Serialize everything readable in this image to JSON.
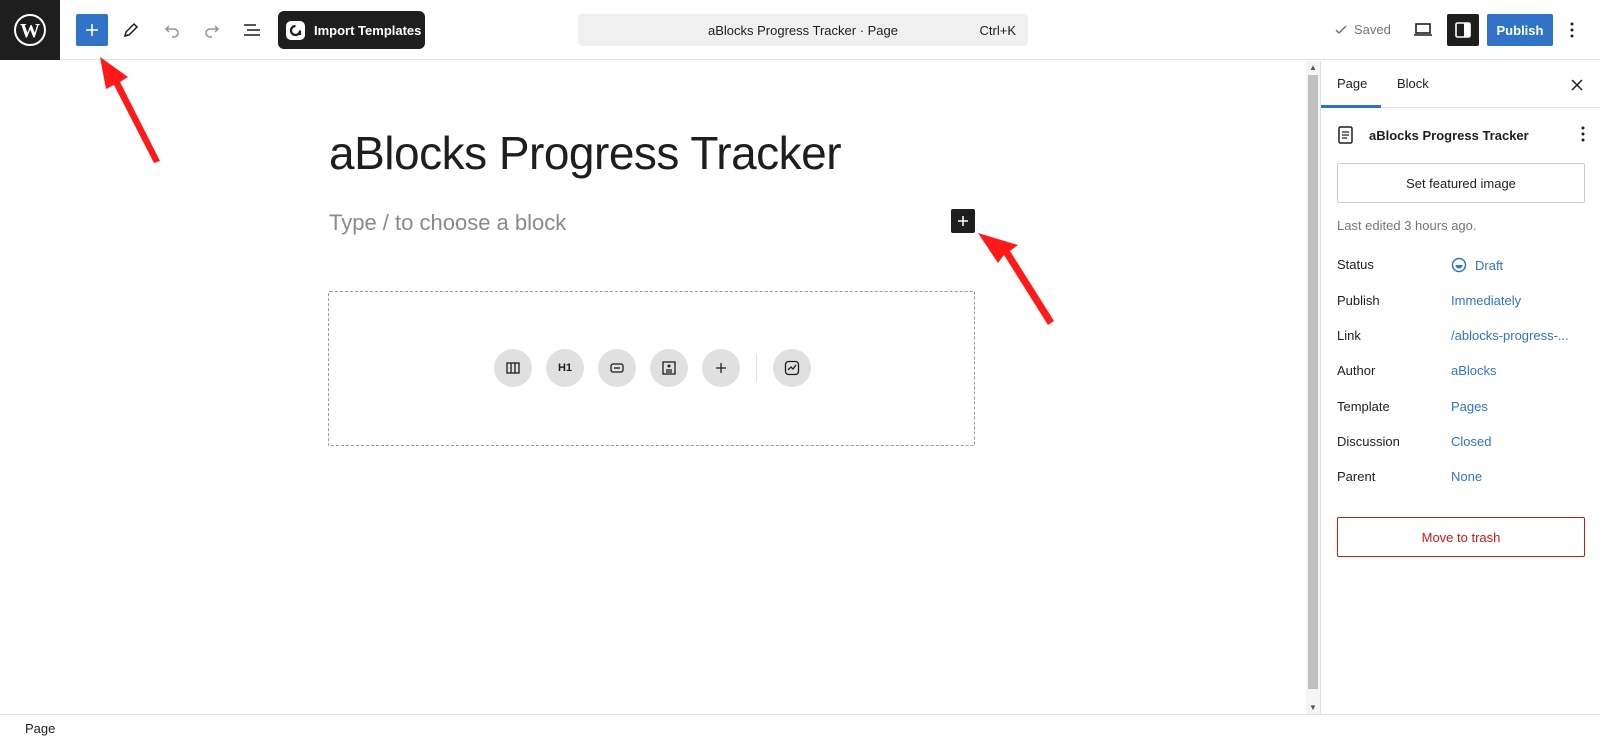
{
  "toolbar": {
    "import_label": "Import Templates",
    "doc_title": "aBlocks Progress Tracker · Page",
    "shortcut": "Ctrl+K",
    "saved_label": "Saved",
    "publish_label": "Publish"
  },
  "editor": {
    "title": "aBlocks Progress Tracker",
    "placeholder": "Type / to choose a block",
    "pattern_icons": [
      "columns-icon",
      "heading-icon",
      "button-icon",
      "media-text-icon",
      "plus-icon",
      "chart-icon"
    ],
    "heading_glyph": "H1"
  },
  "sidebar": {
    "tabs": [
      "Page",
      "Block"
    ],
    "active_tab": "Page",
    "doc_title": "aBlocks Progress Tracker",
    "featured_image_label": "Set featured image",
    "last_edited": "Last edited 3 hours ago.",
    "meta": [
      {
        "label": "Status",
        "value": "Draft"
      },
      {
        "label": "Publish",
        "value": "Immediately"
      },
      {
        "label": "Link",
        "value": "/ablocks-progress-..."
      },
      {
        "label": "Author",
        "value": "aBlocks"
      },
      {
        "label": "Template",
        "value": "Pages"
      },
      {
        "label": "Discussion",
        "value": "Closed"
      },
      {
        "label": "Parent",
        "value": "None"
      }
    ],
    "trash_label": "Move to trash"
  },
  "footer": {
    "breadcrumb": "Page"
  },
  "colors": {
    "accent": "#3173c6",
    "dark": "#1e1e1e",
    "danger": "#cc1818",
    "annotation_arrow": "#ff1a1a"
  }
}
